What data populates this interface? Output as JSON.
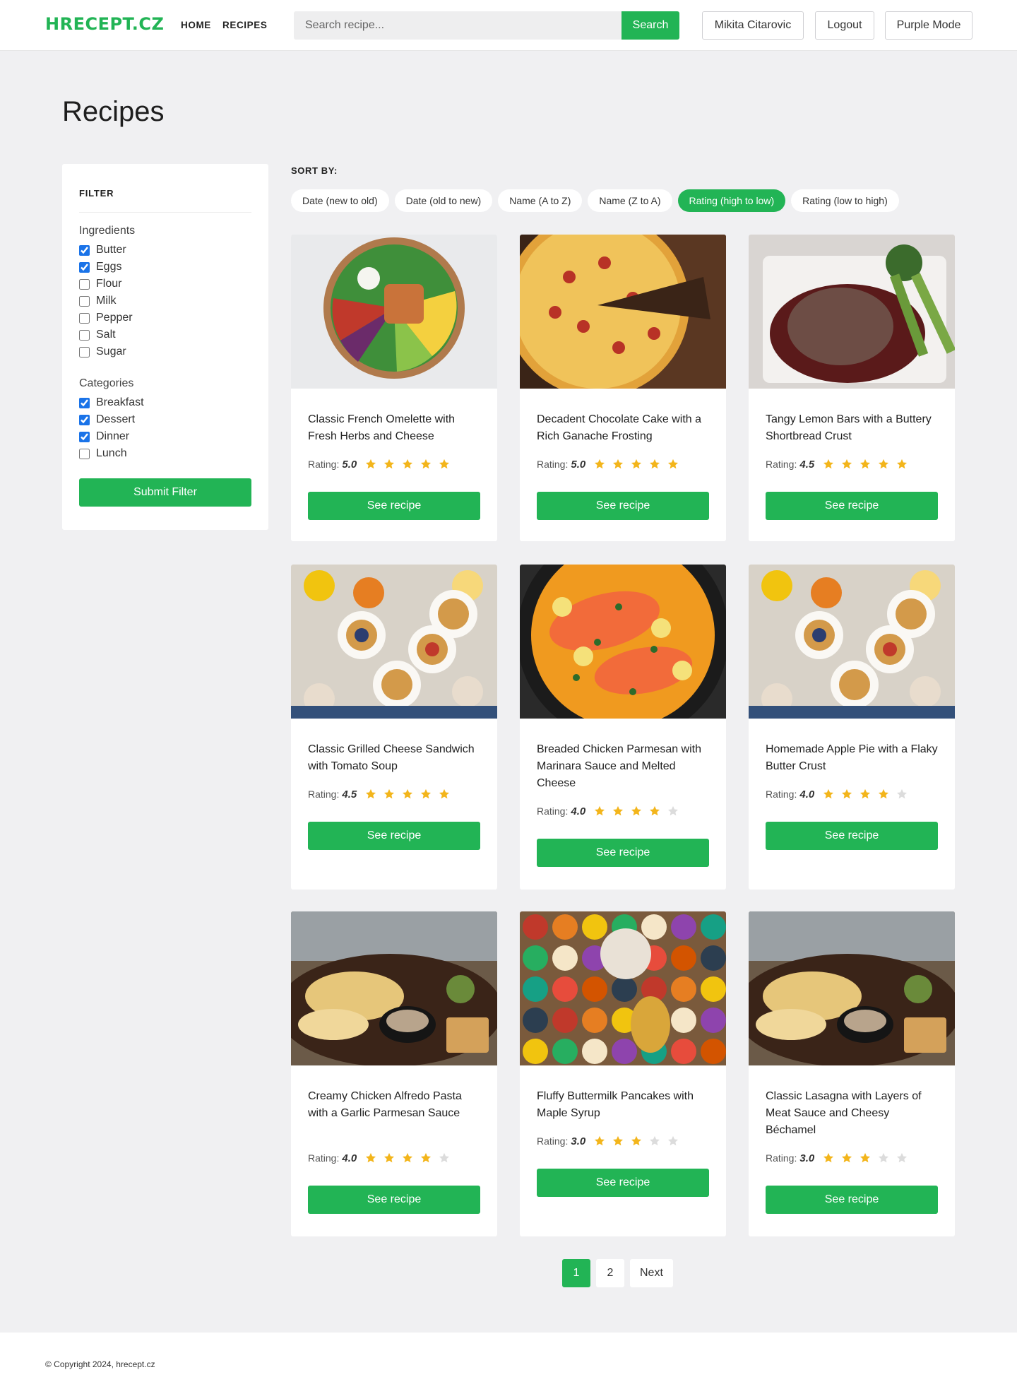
{
  "header": {
    "logo": "HRECEPT.CZ",
    "nav": [
      "HOME",
      "RECIPES"
    ],
    "search_placeholder": "Search recipe...",
    "search_button": "Search",
    "user_name": "Mikita Citarovic",
    "logout": "Logout",
    "theme_toggle": "Purple Mode"
  },
  "page_title": "Recipes",
  "filter": {
    "heading": "FILTER",
    "ingredients_title": "Ingredients",
    "ingredients": [
      {
        "label": "Butter",
        "checked": true
      },
      {
        "label": "Eggs",
        "checked": true
      },
      {
        "label": "Flour",
        "checked": false
      },
      {
        "label": "Milk",
        "checked": false
      },
      {
        "label": "Pepper",
        "checked": false
      },
      {
        "label": "Salt",
        "checked": false
      },
      {
        "label": "Sugar",
        "checked": false
      }
    ],
    "categories_title": "Categories",
    "categories": [
      {
        "label": "Breakfast",
        "checked": true
      },
      {
        "label": "Dessert",
        "checked": true
      },
      {
        "label": "Dinner",
        "checked": true
      },
      {
        "label": "Lunch",
        "checked": false
      }
    ],
    "submit": "Submit Filter"
  },
  "sort": {
    "label": "SORT BY:",
    "options": [
      "Date (new to old)",
      "Date (old to new)",
      "Name (A to Z)",
      "Name (Z to A)",
      "Rating (high to low)",
      "Rating (low to high)"
    ],
    "active": "Rating (high to low)"
  },
  "rating_label": "Rating:",
  "see_recipe": "See recipe",
  "recipes": [
    {
      "title": "Classic French Omelette with Fresh Herbs and Cheese",
      "rating": "5.0",
      "stars": 5,
      "image": "salad-bowl"
    },
    {
      "title": "Decadent Chocolate Cake with a Rich Ganache Frosting",
      "rating": "5.0",
      "stars": 5,
      "image": "pizza"
    },
    {
      "title": "Tangy Lemon Bars with a Buttery Shortbread Crust",
      "rating": "4.5",
      "stars": 5,
      "image": "steak"
    },
    {
      "title": "Classic Grilled Cheese Sandwich with Tomato Soup",
      "rating": "4.5",
      "stars": 5,
      "image": "breakfast-spread"
    },
    {
      "title": "Breaded Chicken Parmesan with Marinara Sauce and Melted Cheese",
      "rating": "4.0",
      "stars": 4,
      "image": "salmon-pan"
    },
    {
      "title": "Homemade Apple Pie with a Flaky Butter Crust",
      "rating": "4.0",
      "stars": 4,
      "image": "breakfast-spread"
    },
    {
      "title": "Creamy Chicken Alfredo Pasta with a Garlic Parmesan Sauce",
      "rating": "4.0",
      "stars": 4,
      "image": "chicken-platter"
    },
    {
      "title": "Fluffy Buttermilk Pancakes with Maple Syrup",
      "rating": "3.0",
      "stars": 3,
      "image": "fruit-spread"
    },
    {
      "title": "Classic Lasagna with Layers of Meat Sauce and Cheesy Béchamel",
      "rating": "3.0",
      "stars": 3,
      "image": "chicken-platter"
    }
  ],
  "pagination": {
    "pages": [
      "1",
      "2"
    ],
    "active": "1",
    "next": "Next"
  },
  "footer": {
    "copyright": "© Copyright 2024, hrecept.cz"
  },
  "colors": {
    "accent": "#22b455",
    "star_on": "#f3b51b",
    "star_off": "#dcdcdc",
    "background": "#f0f0f2"
  }
}
